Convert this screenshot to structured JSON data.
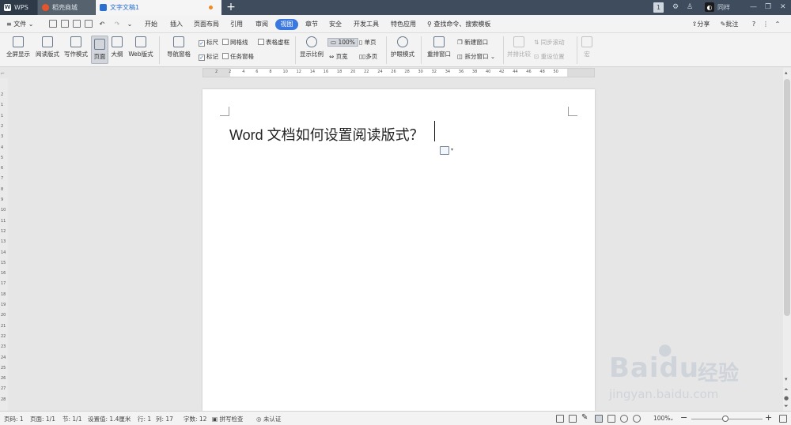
{
  "titlebar": {
    "tabs": [
      {
        "label": "WPS",
        "icon": "wps-logo-icon"
      },
      {
        "label": "稻壳商城",
        "icon": "docer-store-icon"
      },
      {
        "label": "文字文稿1",
        "icon": "writer-doc-icon"
      }
    ],
    "page_badge": "1",
    "user_label": "同样"
  },
  "menubar": {
    "file_label": "文件",
    "items": [
      "开始",
      "插入",
      "页面布局",
      "引用",
      "审阅",
      "视图",
      "章节",
      "安全",
      "开发工具",
      "特色应用"
    ],
    "active": "视图",
    "search_label": "查找命令、搜索模板",
    "share_label": "分享",
    "comment_label": "批注"
  },
  "ribbon": {
    "fullscreen": "全屏显示",
    "reading_layout": "阅读版式",
    "write_mode": "写作模式",
    "page_view": "页面",
    "outline": "大纲",
    "web_layout": "Web版式",
    "nav_pane": "导航窗格",
    "ruler": "标尺",
    "gridlines": "网格线",
    "table_gridlines": "表格虚框",
    "marks": "标记",
    "task_pane": "任务窗格",
    "zoom_ratio": "显示比例",
    "zoom_100": "100%",
    "single_page": "单页",
    "page_width": "页宽",
    "multi_page": "多页",
    "eye_mode": "护眼模式",
    "rearrange_window": "重排窗口",
    "new_window": "新建窗口",
    "split_window": "拆分窗口",
    "side_by_side": "并排比较",
    "sync_scroll": "同步滚动",
    "reset_position": "重设位置",
    "macro": "宏"
  },
  "ruler": {
    "h_ticks": [
      "2",
      "2",
      "4",
      "6",
      "8",
      "10",
      "12",
      "14",
      "16",
      "18",
      "20",
      "22",
      "24",
      "26",
      "28",
      "30",
      "32",
      "34",
      "36",
      "38",
      "40",
      "42",
      "44",
      "46",
      "48",
      "50"
    ],
    "v_ticks": [
      "2",
      "1",
      "1",
      "2",
      "3",
      "4",
      "5",
      "6",
      "7",
      "8",
      "9",
      "10",
      "11",
      "12",
      "13",
      "14",
      "15",
      "16",
      "17",
      "18",
      "19",
      "20",
      "21",
      "22",
      "23",
      "24",
      "25",
      "26",
      "27",
      "28"
    ]
  },
  "document": {
    "text": "Word  文档如何设置阅读版式？"
  },
  "statusbar": {
    "page_num": "页码: 1",
    "pages": "页面: 1/1",
    "section": "节: 1/1",
    "position": "设置值: 1.4厘米",
    "row": "行: 1",
    "col": "列: 17",
    "word_count": "字数: 12",
    "spellcheck": "拼写检查",
    "auth": "未认证",
    "zoom": "100%"
  },
  "watermark": {
    "brand": "Baidu",
    "cn": "经验",
    "url": "jingyan.baidu.com"
  },
  "colors": {
    "titlebar": "#3e4c5e",
    "accent": "#3a78e0",
    "doc_tab_text": "#2b6fd0",
    "unsaved_dot": "#f08a24"
  }
}
